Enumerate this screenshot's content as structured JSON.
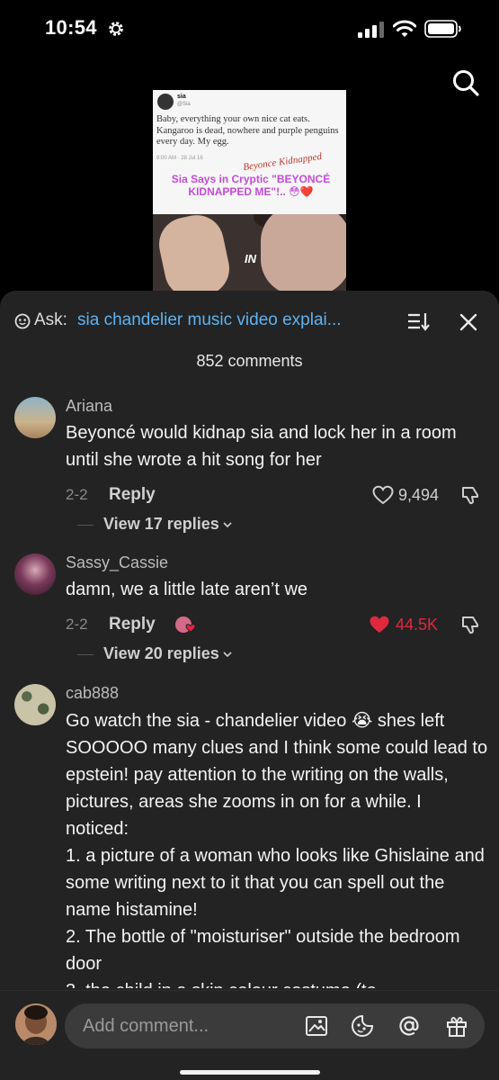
{
  "status_bar": {
    "time": "10:54"
  },
  "video": {
    "tweet": {
      "name": "sia",
      "handle": "@Sia",
      "text": "Baby, everything your own nice cat eats. Kangaroo is dead, nowhere and purple penguins every day. My egg.",
      "date": "9:00 AM · 28 Jul 16",
      "scrawl": "Beyonce Kidnapped"
    },
    "caption": "Sia Says in Cryptic \"BEYONCÉ KIDNAPPED ME\"!.. 😳❤️",
    "overlay_text": "IN"
  },
  "comments_sheet": {
    "ask_label": "Ask:",
    "ask_query": "sia chandelier music video explai...",
    "count_label": "852 comments",
    "comments": [
      {
        "username": "Ariana",
        "text": "Beyoncé would kidnap sia and lock her in a room until she wrote a hit song for her",
        "date": "2-2",
        "reply_label": "Reply",
        "likes": "9,494",
        "liked": false,
        "view_replies": "View 17 replies"
      },
      {
        "username": "Sassy_Cassie",
        "text": "damn, we a little late aren’t we",
        "date": "2-2",
        "reply_label": "Reply",
        "likes": "44.5K",
        "liked": true,
        "view_replies": "View 20 replies"
      },
      {
        "username": "cab888",
        "text": "Go watch the sia - chandelier video 😭 shes left SOOOOO many clues and I think some could lead to epstein! pay attention to the writing on the walls, pictures, areas she zooms in on for a while. I noticed:\n1. a picture of a woman who looks like Ghislaine and some writing next to it that you can spell out the name histamine!\n2. The bottle of \"moisturiser\" outside the bedroom door\n3. the child in a skin colour costume (to"
      }
    ]
  },
  "comment_bar": {
    "placeholder": "Add comment..."
  },
  "colors": {
    "sheet_bg": "#232323",
    "link_blue": "#5fb3f0",
    "like_red": "#e0283f"
  }
}
